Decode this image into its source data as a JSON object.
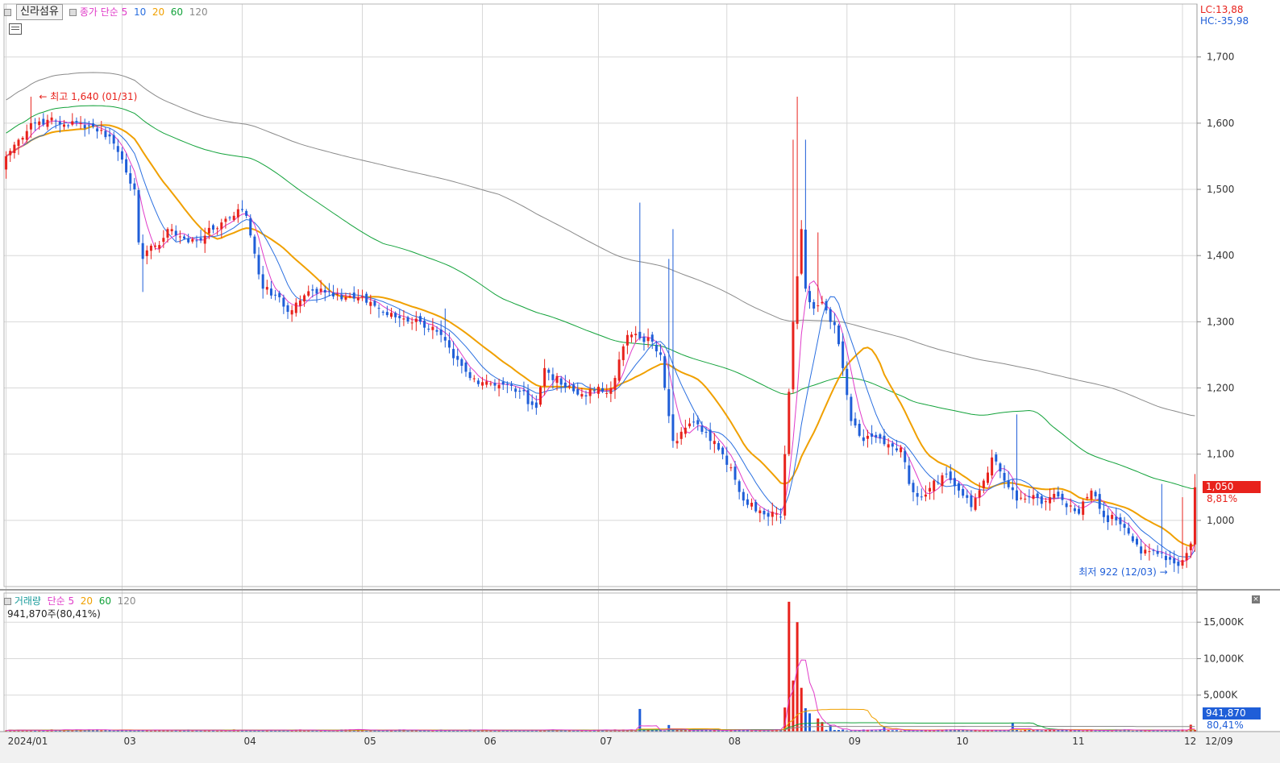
{
  "header": {
    "stock_name": "신라섬유",
    "price_label": "종가",
    "ma_type": "단순",
    "ma_periods": [
      "5",
      "10",
      "20",
      "60",
      "120"
    ],
    "ma_colors": [
      "#e03cc9",
      "#2a6fe0",
      "#f0a000",
      "#12a23a",
      "#8a8a8a"
    ],
    "lc": "LC:13,88",
    "hc": "HC:-35,98"
  },
  "volume_header": {
    "label": "거래량",
    "ma_type": "단순",
    "ma_periods": [
      "5",
      "20",
      "60",
      "120"
    ],
    "ma_colors": [
      "#e03cc9",
      "#f0a000",
      "#12a23a",
      "#8a8a8a"
    ],
    "current": "941,870주(80,41%)"
  },
  "annotations": {
    "high": "최고 1,640 (01/31)",
    "low": "최저 922 (12/03)"
  },
  "price_tag": {
    "value": "1,050",
    "change": "8,81%"
  },
  "volume_tag": {
    "value": "941,870",
    "change": "80,41%"
  },
  "colors": {
    "up": "#e8221c",
    "down": "#1f5ed8",
    "grid": "#d8d8d8"
  },
  "chart_data": {
    "type": "candlestick",
    "x_labels": [
      "2024/01",
      "03",
      "04",
      "05",
      "06",
      "07",
      "08",
      "09",
      "10",
      "11",
      "12",
      "12/09"
    ],
    "y_ticks": [
      1000,
      1100,
      1200,
      1300,
      1400,
      1500,
      1600,
      1700
    ],
    "y_tick_labels": [
      "1,000",
      "1,100",
      "1,200",
      "1,300",
      "1,400",
      "1,500",
      "1,600",
      "1,700"
    ],
    "ylim": [
      900,
      1780
    ],
    "volume_ticks": [
      5000,
      10000,
      15000
    ],
    "volume_tick_labels": [
      "5,000K",
      "10,000K",
      "15,000K"
    ],
    "volume_ylim": [
      0,
      19000
    ],
    "last_close": 1050,
    "last_change_pct": 8.81,
    "last_volume_k": 941.87,
    "high": 1640,
    "low": 922,
    "close_anchors": [
      [
        0,
        1550
      ],
      [
        3,
        1575
      ],
      [
        6,
        1600
      ],
      [
        10,
        1605
      ],
      [
        14,
        1598
      ],
      [
        18,
        1600
      ],
      [
        21,
        1595
      ],
      [
        25,
        1580
      ],
      [
        28,
        1545
      ],
      [
        31,
        1500
      ],
      [
        32,
        1420
      ],
      [
        33,
        1395
      ],
      [
        36,
        1415
      ],
      [
        40,
        1440
      ],
      [
        44,
        1420
      ],
      [
        48,
        1430
      ],
      [
        52,
        1450
      ],
      [
        56,
        1470
      ],
      [
        58,
        1460
      ],
      [
        62,
        1350
      ],
      [
        65,
        1340
      ],
      [
        68,
        1315
      ],
      [
        72,
        1340
      ],
      [
        76,
        1350
      ],
      [
        80,
        1342
      ],
      [
        84,
        1335
      ],
      [
        88,
        1330
      ],
      [
        92,
        1310
      ],
      [
        96,
        1305
      ],
      [
        100,
        1300
      ],
      [
        104,
        1285
      ],
      [
        108,
        1245
      ],
      [
        112,
        1215
      ],
      [
        116,
        1210
      ],
      [
        120,
        1205
      ],
      [
        124,
        1195
      ],
      [
        128,
        1170
      ],
      [
        130,
        1230
      ],
      [
        134,
        1205
      ],
      [
        138,
        1190
      ],
      [
        142,
        1195
      ],
      [
        146,
        1200
      ],
      [
        150,
        1280
      ],
      [
        153,
        1275
      ],
      [
        156,
        1270
      ],
      [
        158,
        1250
      ],
      [
        161,
        1120
      ],
      [
        164,
        1140
      ],
      [
        167,
        1145
      ],
      [
        171,
        1120
      ],
      [
        175,
        1080
      ],
      [
        178,
        1030
      ],
      [
        182,
        1015
      ],
      [
        186,
        1010
      ],
      [
        187,
        1005
      ],
      [
        188,
        1100
      ],
      [
        190,
        1300
      ],
      [
        192,
        1440
      ],
      [
        193,
        1350
      ],
      [
        195,
        1320
      ],
      [
        197,
        1330
      ],
      [
        200,
        1295
      ],
      [
        202,
        1230
      ],
      [
        204,
        1150
      ],
      [
        207,
        1120
      ],
      [
        210,
        1125
      ],
      [
        213,
        1115
      ],
      [
        216,
        1110
      ],
      [
        218,
        1055
      ],
      [
        221,
        1035
      ],
      [
        224,
        1060
      ],
      [
        227,
        1070
      ],
      [
        230,
        1045
      ],
      [
        233,
        1020
      ],
      [
        236,
        1060
      ],
      [
        238,
        1095
      ],
      [
        241,
        1060
      ],
      [
        244,
        1030
      ],
      [
        247,
        1035
      ],
      [
        250,
        1025
      ],
      [
        253,
        1040
      ],
      [
        256,
        1020
      ],
      [
        259,
        1010
      ],
      [
        262,
        1045
      ],
      [
        265,
        1005
      ],
      [
        268,
        1000
      ],
      [
        271,
        980
      ],
      [
        274,
        950
      ],
      [
        277,
        955
      ],
      [
        280,
        940
      ],
      [
        282,
        935
      ],
      [
        284,
        940
      ],
      [
        286,
        965
      ],
      [
        287,
        1050
      ]
    ],
    "volume_spikes_k": [
      [
        153,
        3100
      ],
      [
        160,
        900
      ],
      [
        188,
        3300
      ],
      [
        189,
        17800
      ],
      [
        190,
        7000
      ],
      [
        191,
        15000
      ],
      [
        192,
        6000
      ],
      [
        193,
        3200
      ],
      [
        194,
        2500
      ],
      [
        196,
        1800
      ],
      [
        197,
        1300
      ],
      [
        199,
        900
      ],
      [
        212,
        700
      ],
      [
        243,
        1200
      ],
      [
        286,
        941.87
      ]
    ]
  }
}
